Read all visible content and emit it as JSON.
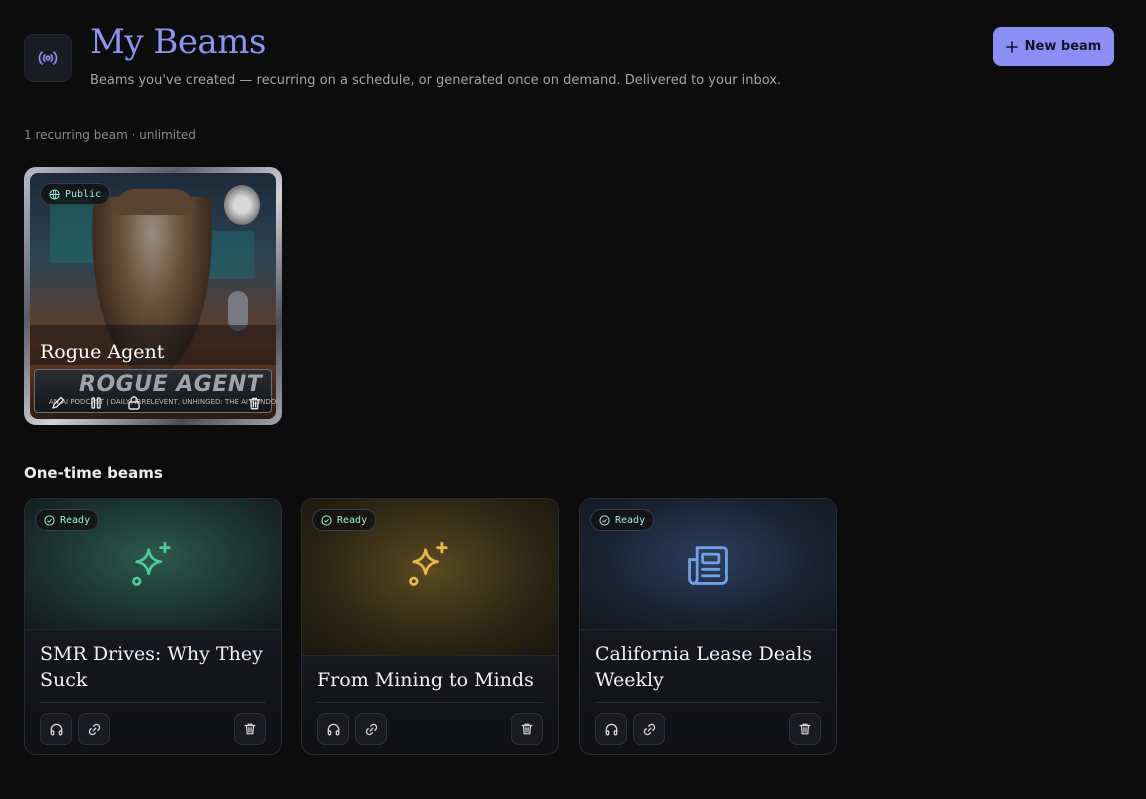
{
  "header": {
    "icon": "broadcast-icon",
    "title": "My Beams",
    "subtitle": "Beams you've created — recurring on a schedule, or generated once on demand. Delivered to your inbox.",
    "new_beam_label": "New beam"
  },
  "recurring": {
    "count_text": "1 recurring beam · unlimited",
    "cards": [
      {
        "badge": "Public",
        "title": "Rogue Agent",
        "logo_text": "ROGUE AGENT",
        "tagline": "AN AI PODCAST | DAILY, IRRELEVENT, UNHINGED: THE AI RUNDOWN",
        "actions": [
          "pencil-icon",
          "pause-icon",
          "lock-icon",
          "trash-icon"
        ]
      }
    ]
  },
  "one_time": {
    "section_title": "One-time beams",
    "cards": [
      {
        "badge": "Ready",
        "title": "SMR Drives: Why They Suck",
        "icon": "sparkles-icon",
        "accent": "#4fc99a"
      },
      {
        "badge": "Ready",
        "title": "From Mining to Minds",
        "icon": "sparkles-icon",
        "accent": "#e6b84f"
      },
      {
        "badge": "Ready",
        "title": "California Lease Deals Weekly",
        "icon": "newspaper-icon",
        "accent": "#6fa0e6"
      }
    ]
  },
  "colors": {
    "background": "#0c0c0d",
    "accent": "#8b8ff5",
    "title": "#8f94f0",
    "badge_text": "#a9e8cf"
  }
}
